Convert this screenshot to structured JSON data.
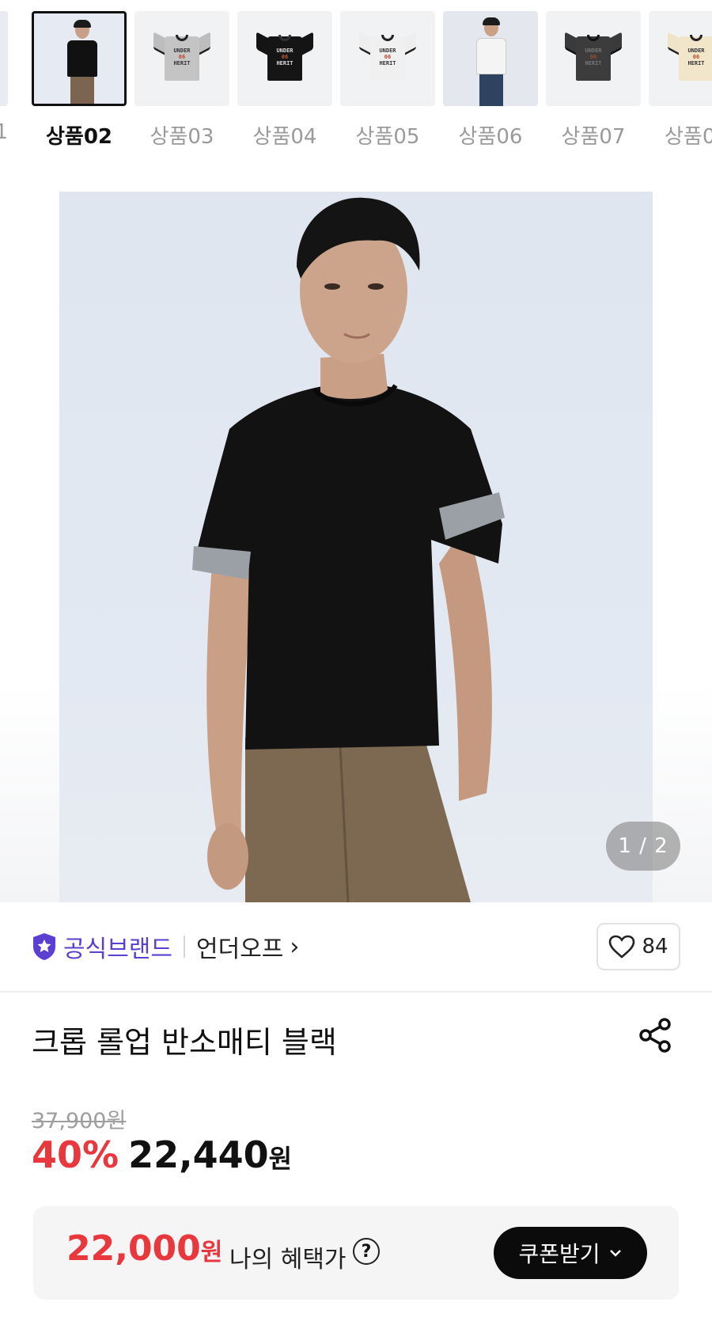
{
  "thumbnails": [
    {
      "label": "1"
    },
    {
      "label": "상품02"
    },
    {
      "label": "상품03"
    },
    {
      "label": "상품04"
    },
    {
      "label": "상품05"
    },
    {
      "label": "상품06"
    },
    {
      "label": "상품07"
    },
    {
      "label": "상품0"
    }
  ],
  "gallery": {
    "counter": "1 / 2"
  },
  "brand": {
    "official_label": "공식브랜드",
    "name": "언더오프",
    "chevron": "›",
    "like_count": "84"
  },
  "product": {
    "title": "크롭 롤업 반소매티 블랙",
    "original_price": "37,900원",
    "discount_rate": "40%",
    "sale_price": "22,440",
    "sale_unit": "원"
  },
  "benefit": {
    "amount": "22,000",
    "unit": "원",
    "label": "나의 혜택가",
    "help": "?",
    "coupon_label": "쿠폰받기"
  },
  "colors": {
    "accent_red": "#e8373d",
    "brand_purple": "#5b3fd1",
    "button_black": "#0b0b0b"
  }
}
